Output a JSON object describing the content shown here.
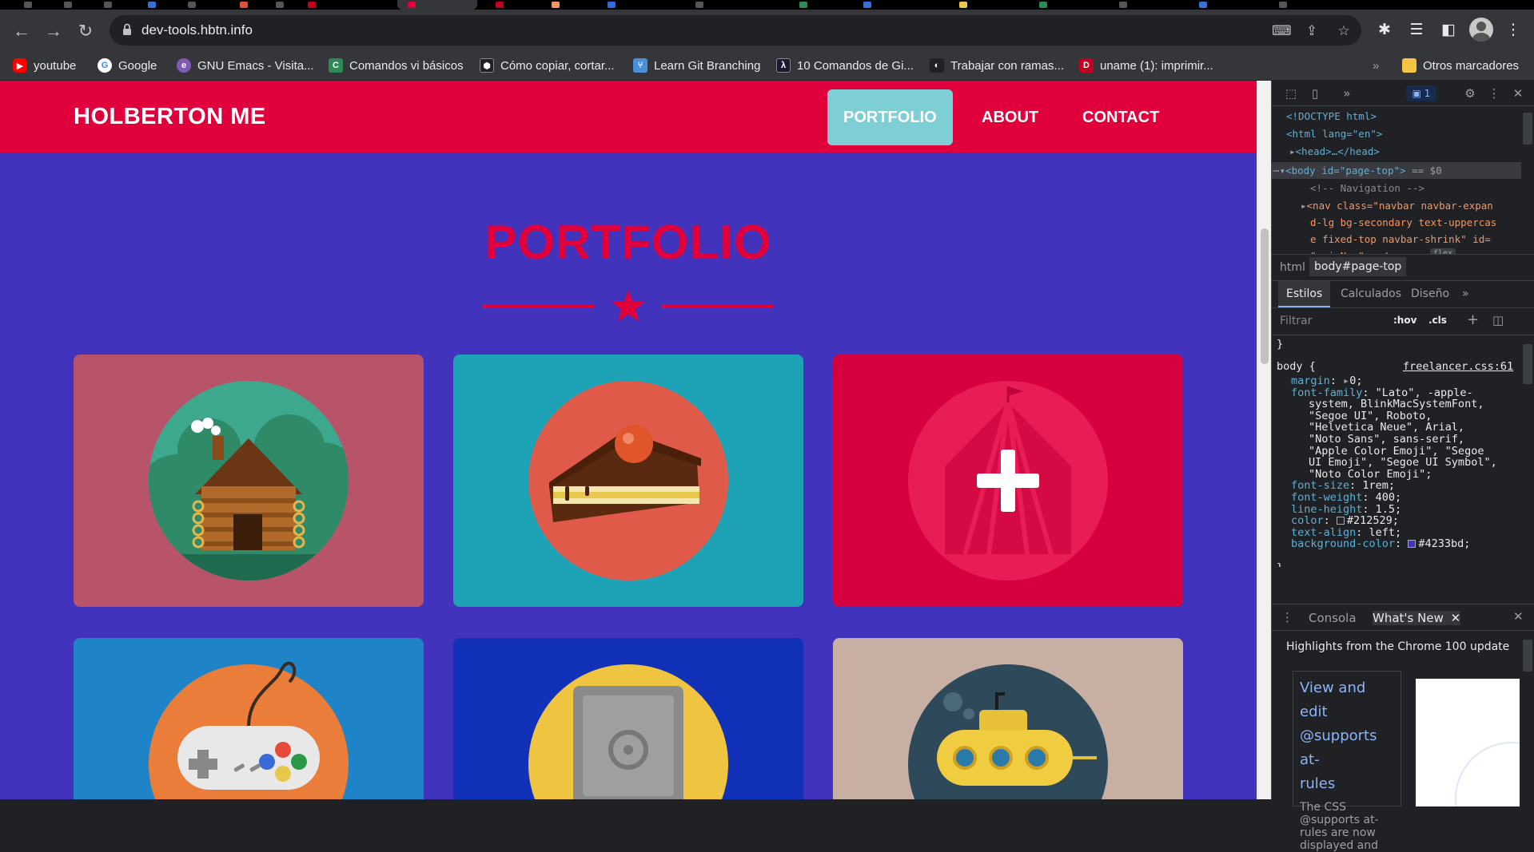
{
  "browser": {
    "url": "dev-tools.hbtn.info",
    "bookmarks": [
      {
        "label": "youtube",
        "icon": "youtube-icon",
        "color": "#ff0000"
      },
      {
        "label": "Google",
        "icon": "google-icon",
        "color": "#ffffff"
      },
      {
        "label": "GNU Emacs - Visita...",
        "icon": "emacs-icon",
        "color": "#7f5ab6"
      },
      {
        "label": "Comandos vi básicos",
        "icon": "vi-icon",
        "color": "#2e8b57"
      },
      {
        "label": "Cómo copiar, cortar...",
        "icon": "cube-icon",
        "color": "#202124"
      },
      {
        "label": "Learn Git Branching",
        "icon": "git-branching-icon",
        "color": "#4a90d9"
      },
      {
        "label": "10 Comandos de Gi...",
        "icon": "dev-icon",
        "color": "#1a1a2e"
      },
      {
        "label": "Trabajar con ramas...",
        "icon": "leaf-icon",
        "color": "#202124"
      },
      {
        "label": "uname (1): imprimir...",
        "icon": "manpage-icon",
        "color": "#c00020"
      }
    ],
    "more_bookmarks": "»",
    "other_bookmarks": "Otros marcadores"
  },
  "site": {
    "brand": "HOLBERTON ME",
    "nav": [
      "PORTFOLIO",
      "ABOUT",
      "CONTACT"
    ],
    "section_title": "PORTFOLIO",
    "colors": {
      "nav": "#e0003b",
      "background": "#4233bd",
      "active_link": "#7dcfd5"
    },
    "cards": [
      {
        "name": "cabin",
        "bg": "#b8546a"
      },
      {
        "name": "cake",
        "bg": "#1da3b5"
      },
      {
        "name": "circus",
        "bg": "#d6003e"
      },
      {
        "name": "game-controller",
        "bg": "#1f84c7"
      },
      {
        "name": "safe",
        "bg": "#1131b8"
      },
      {
        "name": "submarine",
        "bg": "#c8afa3"
      }
    ]
  },
  "devtools": {
    "issues_count": "1",
    "elements": {
      "doctype": "<!DOCTYPE html>",
      "html_open": "<html lang=\"en\">",
      "head": "<head>…</head>",
      "body_tag": "<body id=\"page-top\">",
      "body_suffix": " == $0",
      "comment": "<!-- Navigation -->",
      "nav_lines": [
        "<nav class=\"navbar navbar-expan",
        "d-lg bg-secondary text-uppercas",
        "e fixed-top navbar-shrink\" id=",
        "\"mainNav\">…</nav>"
      ],
      "flex_badge": "flex"
    },
    "breadcrumbs": [
      "html",
      "body#page-top"
    ],
    "styles_tabs": [
      "Estilos",
      "Calculados",
      "Diseño"
    ],
    "filter_placeholder": "Filtrar",
    "hov": ":hov",
    "cls": ".cls",
    "closing_brace": "}",
    "rule": {
      "selector": "body {",
      "source": "freelancer.css:61",
      "lines": [
        {
          "prop": "margin",
          "val": "0;",
          "arrow": true
        },
        {
          "prop": "font-family",
          "val": "\"Lato\", -apple-"
        },
        {
          "cont": "system, BlinkMacSystemFont,"
        },
        {
          "cont": "\"Segoe UI\", Roboto,"
        },
        {
          "cont": "\"Helvetica Neue\", Arial,"
        },
        {
          "cont": "\"Noto Sans\", sans-serif,"
        },
        {
          "cont": "\"Apple Color Emoji\", \"Segoe"
        },
        {
          "cont": "UI Emoji\", \"Segoe UI Symbol\","
        },
        {
          "cont": "\"Noto Color Emoji\";"
        },
        {
          "prop": "font-size",
          "val": "1rem;"
        },
        {
          "prop": "font-weight",
          "val": "400;"
        },
        {
          "prop": "line-height",
          "val": "1.5;"
        },
        {
          "prop": "color",
          "val": "#212529;",
          "swatch": "#212529"
        },
        {
          "prop": "text-align",
          "val": "left;"
        },
        {
          "prop": "background-color",
          "val": "#4233bd;",
          "swatch": "#4233bd"
        }
      ],
      "end": "}"
    },
    "drawer": {
      "tabs": [
        "Consola",
        "What's New"
      ],
      "headline": "Highlights from the Chrome 100 update",
      "card_title": [
        "View and edit",
        "@supports at-",
        "rules"
      ],
      "card_body": [
        "The CSS",
        "@supports at-",
        "rules are now",
        "displayed and"
      ]
    }
  }
}
